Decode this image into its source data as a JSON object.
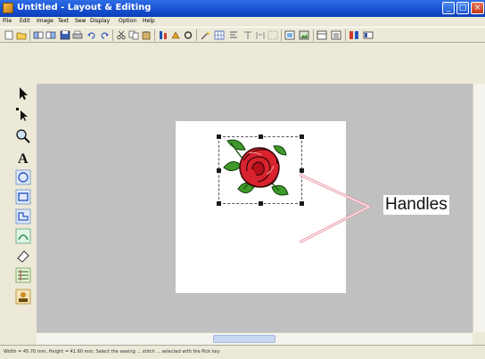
{
  "window": {
    "title": "Untitled - Layout & Editing"
  },
  "menu": {
    "items": [
      "File",
      "Edit",
      "Image",
      "Text",
      "Sew",
      "Display",
      "Option",
      "Help"
    ]
  },
  "toolbar": {
    "buttons": [
      "new-icon",
      "open-icon",
      "save-icon",
      "print-icon",
      "undo-icon",
      "redo-icon",
      "cut-icon",
      "copy-icon",
      "paste-icon",
      "sewing-attributes-icon",
      "zoom-icon",
      "settings-icon"
    ]
  },
  "tools": [
    "select-arrow-icon",
    "point-edit-icon",
    "zoom-icon",
    "text-icon",
    "circle-icon",
    "rectangle-icon",
    "shape-icon",
    "stamp-icon",
    "eraser-icon",
    "manual-punch-icon",
    "import-icon"
  ],
  "canvas": {
    "design": "rose-embroidery-image"
  },
  "callout": {
    "label": "Handles"
  },
  "status": {
    "text": "Width = 45.70 mm, Height = 41.60 mm; Select the sewing ... stitch ... selected with the Pick key"
  },
  "colors": {
    "titlebar": "#1b55d6",
    "workspace": "#c0c0c0",
    "callout_line": "#e89aa8",
    "rose": "#d8232e",
    "leaf": "#3d9a2a"
  }
}
